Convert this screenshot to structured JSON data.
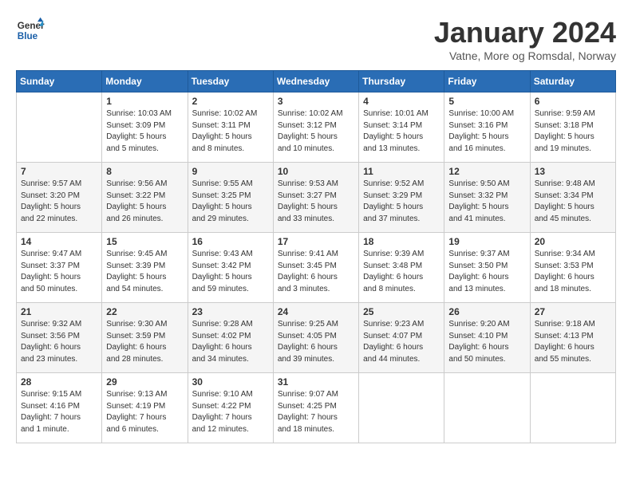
{
  "header": {
    "logo_line1": "General",
    "logo_line2": "Blue",
    "month": "January 2024",
    "location": "Vatne, More og Romsdal, Norway"
  },
  "weekdays": [
    "Sunday",
    "Monday",
    "Tuesday",
    "Wednesday",
    "Thursday",
    "Friday",
    "Saturday"
  ],
  "weeks": [
    [
      {
        "day": "",
        "info": ""
      },
      {
        "day": "1",
        "info": "Sunrise: 10:03 AM\nSunset: 3:09 PM\nDaylight: 5 hours\nand 5 minutes."
      },
      {
        "day": "2",
        "info": "Sunrise: 10:02 AM\nSunset: 3:11 PM\nDaylight: 5 hours\nand 8 minutes."
      },
      {
        "day": "3",
        "info": "Sunrise: 10:02 AM\nSunset: 3:12 PM\nDaylight: 5 hours\nand 10 minutes."
      },
      {
        "day": "4",
        "info": "Sunrise: 10:01 AM\nSunset: 3:14 PM\nDaylight: 5 hours\nand 13 minutes."
      },
      {
        "day": "5",
        "info": "Sunrise: 10:00 AM\nSunset: 3:16 PM\nDaylight: 5 hours\nand 16 minutes."
      },
      {
        "day": "6",
        "info": "Sunrise: 9:59 AM\nSunset: 3:18 PM\nDaylight: 5 hours\nand 19 minutes."
      }
    ],
    [
      {
        "day": "7",
        "info": "Sunrise: 9:57 AM\nSunset: 3:20 PM\nDaylight: 5 hours\nand 22 minutes."
      },
      {
        "day": "8",
        "info": "Sunrise: 9:56 AM\nSunset: 3:22 PM\nDaylight: 5 hours\nand 26 minutes."
      },
      {
        "day": "9",
        "info": "Sunrise: 9:55 AM\nSunset: 3:25 PM\nDaylight: 5 hours\nand 29 minutes."
      },
      {
        "day": "10",
        "info": "Sunrise: 9:53 AM\nSunset: 3:27 PM\nDaylight: 5 hours\nand 33 minutes."
      },
      {
        "day": "11",
        "info": "Sunrise: 9:52 AM\nSunset: 3:29 PM\nDaylight: 5 hours\nand 37 minutes."
      },
      {
        "day": "12",
        "info": "Sunrise: 9:50 AM\nSunset: 3:32 PM\nDaylight: 5 hours\nand 41 minutes."
      },
      {
        "day": "13",
        "info": "Sunrise: 9:48 AM\nSunset: 3:34 PM\nDaylight: 5 hours\nand 45 minutes."
      }
    ],
    [
      {
        "day": "14",
        "info": "Sunrise: 9:47 AM\nSunset: 3:37 PM\nDaylight: 5 hours\nand 50 minutes."
      },
      {
        "day": "15",
        "info": "Sunrise: 9:45 AM\nSunset: 3:39 PM\nDaylight: 5 hours\nand 54 minutes."
      },
      {
        "day": "16",
        "info": "Sunrise: 9:43 AM\nSunset: 3:42 PM\nDaylight: 5 hours\nand 59 minutes."
      },
      {
        "day": "17",
        "info": "Sunrise: 9:41 AM\nSunset: 3:45 PM\nDaylight: 6 hours\nand 3 minutes."
      },
      {
        "day": "18",
        "info": "Sunrise: 9:39 AM\nSunset: 3:48 PM\nDaylight: 6 hours\nand 8 minutes."
      },
      {
        "day": "19",
        "info": "Sunrise: 9:37 AM\nSunset: 3:50 PM\nDaylight: 6 hours\nand 13 minutes."
      },
      {
        "day": "20",
        "info": "Sunrise: 9:34 AM\nSunset: 3:53 PM\nDaylight: 6 hours\nand 18 minutes."
      }
    ],
    [
      {
        "day": "21",
        "info": "Sunrise: 9:32 AM\nSunset: 3:56 PM\nDaylight: 6 hours\nand 23 minutes."
      },
      {
        "day": "22",
        "info": "Sunrise: 9:30 AM\nSunset: 3:59 PM\nDaylight: 6 hours\nand 28 minutes."
      },
      {
        "day": "23",
        "info": "Sunrise: 9:28 AM\nSunset: 4:02 PM\nDaylight: 6 hours\nand 34 minutes."
      },
      {
        "day": "24",
        "info": "Sunrise: 9:25 AM\nSunset: 4:05 PM\nDaylight: 6 hours\nand 39 minutes."
      },
      {
        "day": "25",
        "info": "Sunrise: 9:23 AM\nSunset: 4:07 PM\nDaylight: 6 hours\nand 44 minutes."
      },
      {
        "day": "26",
        "info": "Sunrise: 9:20 AM\nSunset: 4:10 PM\nDaylight: 6 hours\nand 50 minutes."
      },
      {
        "day": "27",
        "info": "Sunrise: 9:18 AM\nSunset: 4:13 PM\nDaylight: 6 hours\nand 55 minutes."
      }
    ],
    [
      {
        "day": "28",
        "info": "Sunrise: 9:15 AM\nSunset: 4:16 PM\nDaylight: 7 hours\nand 1 minute."
      },
      {
        "day": "29",
        "info": "Sunrise: 9:13 AM\nSunset: 4:19 PM\nDaylight: 7 hours\nand 6 minutes."
      },
      {
        "day": "30",
        "info": "Sunrise: 9:10 AM\nSunset: 4:22 PM\nDaylight: 7 hours\nand 12 minutes."
      },
      {
        "day": "31",
        "info": "Sunrise: 9:07 AM\nSunset: 4:25 PM\nDaylight: 7 hours\nand 18 minutes."
      },
      {
        "day": "",
        "info": ""
      },
      {
        "day": "",
        "info": ""
      },
      {
        "day": "",
        "info": ""
      }
    ]
  ]
}
